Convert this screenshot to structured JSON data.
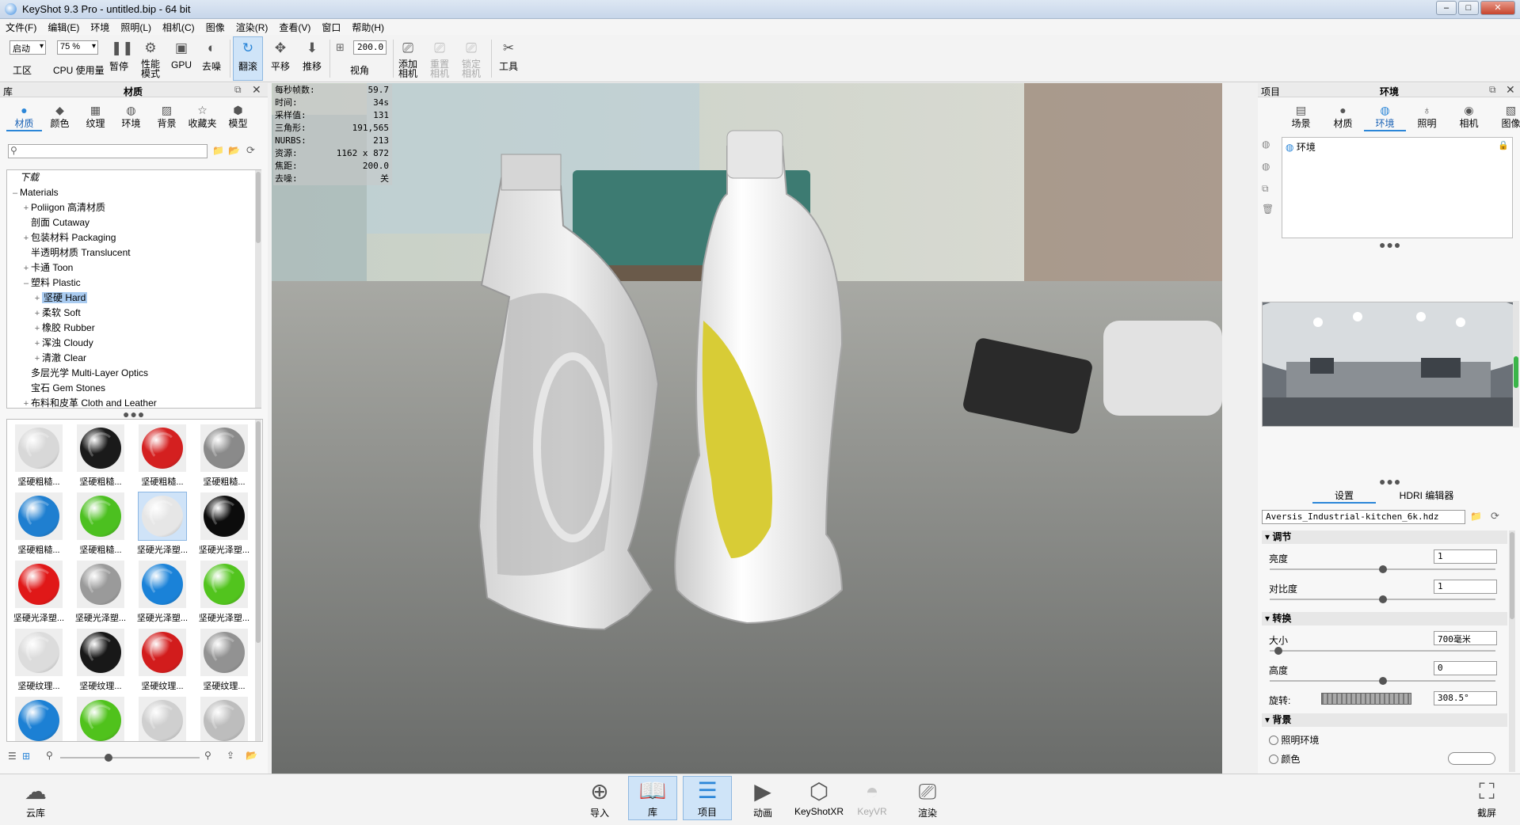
{
  "window": {
    "title": "KeyShot 9.3 Pro  - untitled.bip  - 64 bit",
    "min": "–",
    "max": "□",
    "close": "✕"
  },
  "menu": [
    "文件(F)",
    "编辑(E)",
    "环境",
    "照明(L)",
    "相机(C)",
    "图像",
    "渲染(R)",
    "查看(V)",
    "窗口",
    "帮助(H)"
  ],
  "toolbar": {
    "workspace_value": "启动",
    "workspace_label": "工区",
    "cpu_value": "75 %",
    "cpu_label": "CPU 使用量",
    "pause": "暂停",
    "perf_mode": "性能\n模式",
    "gpu": "GPU",
    "denoise": "去噪",
    "tumble": "翻滚",
    "pan": "平移",
    "dolly": "推移",
    "fov_value": "200.0",
    "fov_label": "视角",
    "add_camera": "添加\n相机",
    "reset_camera": "重置\n相机",
    "lock_camera": "锁定\n相机",
    "tools": "工具"
  },
  "library": {
    "header_left": "库",
    "header_title": "材质",
    "tabs": [
      "材质",
      "颜色",
      "纹理",
      "环境",
      "背景",
      "收藏夹",
      "模型"
    ],
    "search_placeholder": "",
    "tree": [
      {
        "label": "下载",
        "level": 0,
        "exp": "",
        "italic": true
      },
      {
        "label": "Materials",
        "level": 0,
        "exp": "–"
      },
      {
        "label": "Poliigon 高清材质",
        "level": 1,
        "exp": "+"
      },
      {
        "label": "剖面 Cutaway",
        "level": 1,
        "exp": ""
      },
      {
        "label": "包装材料 Packaging",
        "level": 1,
        "exp": "+"
      },
      {
        "label": "半透明材质 Translucent",
        "level": 1,
        "exp": ""
      },
      {
        "label": "卡通 Toon",
        "level": 1,
        "exp": "+"
      },
      {
        "label": "塑料 Plastic",
        "level": 1,
        "exp": "–"
      },
      {
        "label": "坚硬 Hard",
        "level": 2,
        "exp": "+",
        "selected": true
      },
      {
        "label": "柔软 Soft",
        "level": 2,
        "exp": "+"
      },
      {
        "label": "橡胶 Rubber",
        "level": 2,
        "exp": "+"
      },
      {
        "label": "浑浊 Cloudy",
        "level": 2,
        "exp": "+"
      },
      {
        "label": "清澈 Clear",
        "level": 2,
        "exp": "+"
      },
      {
        "label": "多层光学 Multi-Layer Optics",
        "level": 1,
        "exp": ""
      },
      {
        "label": "宝石 Gem Stones",
        "level": 1,
        "exp": ""
      },
      {
        "label": "布料和皮革 Cloth and Leather",
        "level": 1,
        "exp": "+"
      }
    ],
    "materials": [
      {
        "label": "坚硬粗糙...",
        "color": "#d8d8d8"
      },
      {
        "label": "坚硬粗糙...",
        "color": "#1a1a1a"
      },
      {
        "label": "坚硬粗糙...",
        "color": "#d42020"
      },
      {
        "label": "坚硬粗糙...",
        "color": "#8a8a8a"
      },
      {
        "label": "坚硬粗糙...",
        "color": "#1f7fd0"
      },
      {
        "label": "坚硬粗糙...",
        "color": "#4cc020"
      },
      {
        "label": "坚硬光泽塑...",
        "color": "#e6e6e6",
        "highlight": true
      },
      {
        "label": "坚硬光泽塑...",
        "color": "#0c0c0c"
      },
      {
        "label": "坚硬光泽塑...",
        "color": "#e01818"
      },
      {
        "label": "坚硬光泽塑...",
        "color": "#9a9a9a"
      },
      {
        "label": "坚硬光泽塑...",
        "color": "#1a82d8"
      },
      {
        "label": "坚硬光泽塑...",
        "color": "#52c41e"
      },
      {
        "label": "坚硬纹理...",
        "color": "#dcdcdc"
      },
      {
        "label": "坚硬纹理...",
        "color": "#181818"
      },
      {
        "label": "坚硬纹理...",
        "color": "#d21c1c"
      },
      {
        "label": "坚硬纹理...",
        "color": "#929292"
      },
      {
        "label": "",
        "color": "#1c80d4"
      },
      {
        "label": "",
        "color": "#50c21c"
      },
      {
        "label": "",
        "color": "#cfcfcf"
      },
      {
        "label": "",
        "color": "#bdbdbd"
      }
    ]
  },
  "stats": [
    {
      "k": "每秒帧数:",
      "v": "59.7"
    },
    {
      "k": "时间:",
      "v": "34s"
    },
    {
      "k": "采样值:",
      "v": "131"
    },
    {
      "k": "三角形:",
      "v": "191,565"
    },
    {
      "k": "NURBS:",
      "v": "213"
    },
    {
      "k": "资源:",
      "v": "1162 x 872"
    },
    {
      "k": "焦距:",
      "v": "200.0"
    },
    {
      "k": "去噪:",
      "v": "关"
    }
  ],
  "project": {
    "header_left": "项目",
    "header_title": "环境",
    "tabs": [
      "场景",
      "材质",
      "环境",
      "照明",
      "相机",
      "图像"
    ],
    "env_item": "环境",
    "subtabs": [
      "设置",
      "HDRI 编辑器"
    ],
    "hdri_file": "Aversis_Industrial-kitchen_6k.hdz",
    "sections": {
      "adjust": "调节",
      "transform": "转换",
      "background": "背景"
    },
    "brightness_label": "亮度",
    "brightness_value": "1",
    "brightness_level": 0.5,
    "contrast_label": "对比度",
    "contrast_value": "1",
    "contrast_level": 0.5,
    "size_label": "大小",
    "size_value": "700毫米",
    "size_level": 0.02,
    "height_label": "高度",
    "height_value": "0",
    "height_level": 0.5,
    "rotation_label": "旋转:",
    "rotation_value": "308.5°",
    "bg_options": [
      "照明环境",
      "颜色"
    ]
  },
  "bottom": {
    "cloud": "云库",
    "import": "导入",
    "library": "库",
    "project": "项目",
    "animation": "动画",
    "keyshotxr": "KeyShotXR",
    "keyvr": "KeyVR",
    "render": "渲染",
    "screenshot": "截屏"
  }
}
